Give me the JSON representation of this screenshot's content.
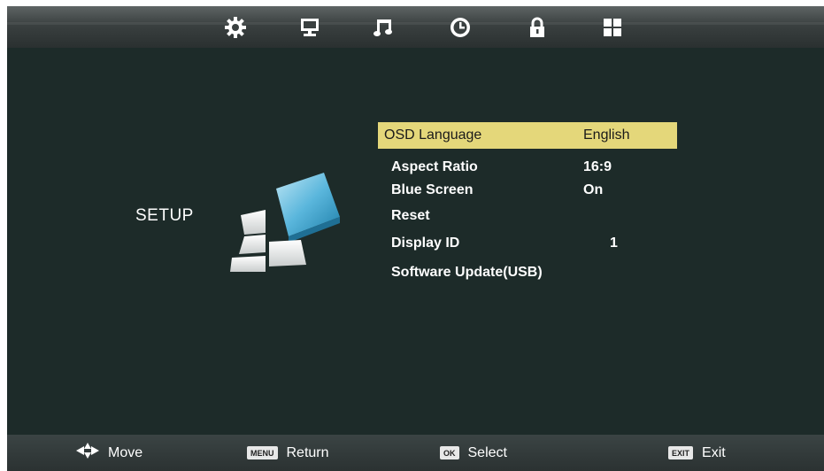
{
  "top_tabs": [
    {
      "icon": "gear-icon",
      "active": true
    },
    {
      "icon": "monitor-icon",
      "active": false
    },
    {
      "icon": "music-note-icon",
      "active": false
    },
    {
      "icon": "clock-icon",
      "active": false
    },
    {
      "icon": "lock-icon",
      "active": false
    },
    {
      "icon": "grid-icon",
      "active": false
    }
  ],
  "section_title": "SETUP",
  "menu": [
    {
      "label": "OSD Language",
      "value": "English",
      "selected": true
    },
    {
      "label": "Aspect Ratio",
      "value": "16:9"
    },
    {
      "label": "Blue Screen",
      "value": "On"
    },
    {
      "label": "Reset",
      "value": ""
    },
    {
      "label": "Display ID",
      "value": "1"
    },
    {
      "label": "Software Update(USB)",
      "value": ""
    }
  ],
  "bottom_hints": {
    "move": {
      "icon": "dpad-arrows-icon",
      "label": "Move"
    },
    "return": {
      "key": "MENU",
      "label": "Return"
    },
    "select": {
      "key": "OK",
      "label": "Select"
    },
    "exit": {
      "key": "EXIT",
      "label": "Exit"
    }
  },
  "colors": {
    "background": "#1d2b29",
    "highlight": "#e4d77a",
    "text": "#ffffff"
  }
}
